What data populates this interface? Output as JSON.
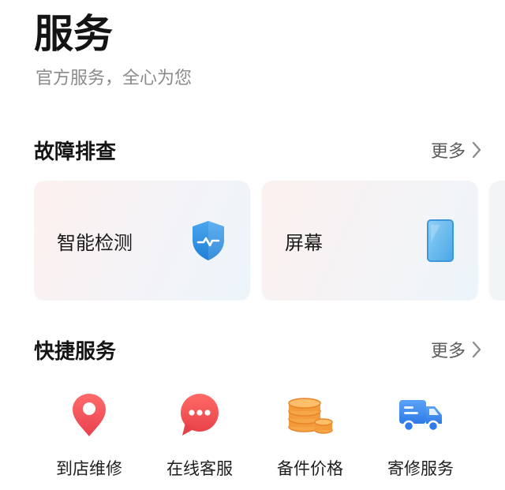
{
  "header": {
    "title": "服务",
    "subtitle": "官方服务，全心为您"
  },
  "troubleshoot": {
    "title": "故障排查",
    "more_label": "更多",
    "cards": [
      {
        "label": "智能检测",
        "icon": "shield-icon"
      },
      {
        "label": "屏幕",
        "icon": "phone-screen-icon"
      }
    ]
  },
  "quick": {
    "title": "快捷服务",
    "more_label": "更多",
    "items": [
      {
        "label": "到店维修",
        "icon": "location-pin-icon"
      },
      {
        "label": "在线客服",
        "icon": "chat-bubble-icon"
      },
      {
        "label": "备件价格",
        "icon": "coins-icon"
      },
      {
        "label": "寄修服务",
        "icon": "delivery-truck-icon"
      }
    ]
  },
  "colors": {
    "shield_blue": "#2e8fe0",
    "pin_red": "#f0505c",
    "chat_red": "#f25450",
    "coin_orange": "#f39a3a",
    "truck_blue": "#3a86ee"
  }
}
